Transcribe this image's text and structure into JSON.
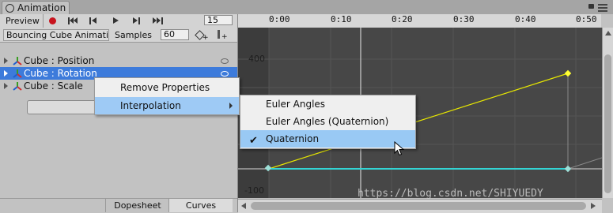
{
  "window": {
    "tab_title": "Animation"
  },
  "toolbar": {
    "preview_label": "Preview",
    "current_frame": "15"
  },
  "clip": {
    "name": "Bouncing Cube Animati ↕",
    "samples_label": "Samples",
    "samples_value": "60"
  },
  "properties": [
    {
      "label": "Cube : Position"
    },
    {
      "label": "Cube : Rotation"
    },
    {
      "label": "Cube : Scale"
    }
  ],
  "add_button": "A",
  "bottom_tabs": {
    "dopesheet": "Dopesheet",
    "curves": "Curves"
  },
  "ruler": [
    "0:00",
    "0:10",
    "0:20",
    "0:30",
    "0:40",
    "0:50"
  ],
  "curve_labels": {
    "top": "400",
    "bottom": "-100"
  },
  "context_menu": {
    "remove": "Remove Properties",
    "interpolation": "Interpolation"
  },
  "submenu": {
    "euler": "Euler Angles",
    "euler_quat": "Euler Angles (Quaternion)",
    "quaternion": "Quaternion"
  },
  "colors": {
    "selection": "#3d7bdb",
    "curve_yellow": "#e8e800",
    "curve_cyan": "#33d4d4",
    "record_red": "#c8141e"
  },
  "watermark": "https://blog.csdn.net/SHIYUEDY"
}
